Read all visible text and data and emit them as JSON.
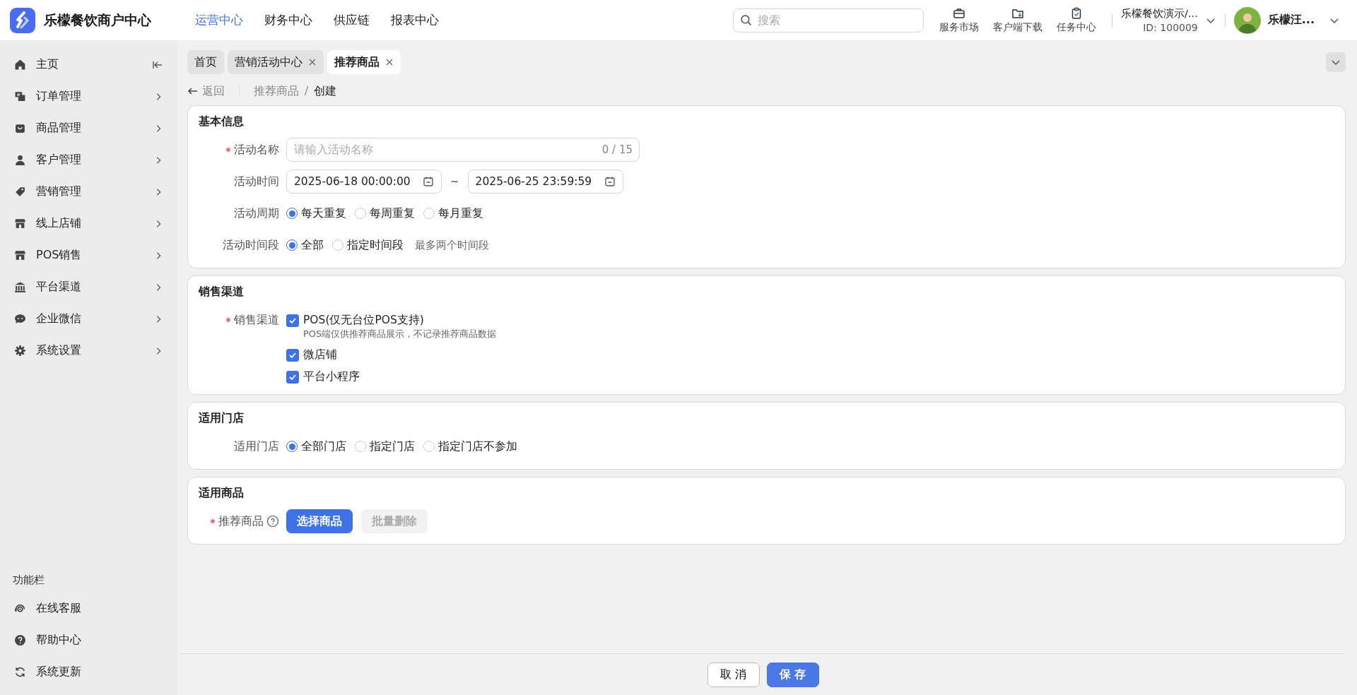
{
  "logo": {
    "title": "乐檬餐饮商户中心"
  },
  "top_nav": [
    {
      "label": "运营中心",
      "selected": true
    },
    {
      "label": "财务中心",
      "selected": false
    },
    {
      "label": "供应链",
      "selected": false
    },
    {
      "label": "报表中心",
      "selected": false
    }
  ],
  "search": {
    "placeholder": "搜索"
  },
  "tools": [
    {
      "label": "服务市场"
    },
    {
      "label": "客户端下载"
    },
    {
      "label": "任务中心"
    }
  ],
  "account": {
    "name": "乐檬餐饮演示/...",
    "id": "ID: 100009"
  },
  "user": {
    "name": "乐檬汪..."
  },
  "sidebar": {
    "items": [
      {
        "label": "主页",
        "kind": "link"
      },
      {
        "label": "订单管理",
        "kind": "menu"
      },
      {
        "label": "商品管理",
        "kind": "menu"
      },
      {
        "label": "客户管理",
        "kind": "menu"
      },
      {
        "label": "营销管理",
        "kind": "menu"
      },
      {
        "label": "线上店铺",
        "kind": "menu"
      },
      {
        "label": "POS销售",
        "kind": "menu"
      },
      {
        "label": "平台渠道",
        "kind": "menu"
      },
      {
        "label": "企业微信",
        "kind": "menu"
      },
      {
        "label": "系统设置",
        "kind": "menu"
      }
    ],
    "section_title": "功能栏",
    "tools": [
      {
        "label": "在线客服"
      },
      {
        "label": "帮助中心"
      },
      {
        "label": "系统更新"
      }
    ]
  },
  "tabs": [
    {
      "label": "首页",
      "closable": false,
      "selected": false
    },
    {
      "label": "营销活动中心",
      "closable": true,
      "selected": false
    },
    {
      "label": "推荐商品",
      "closable": true,
      "selected": true
    }
  ],
  "breadcrumb": {
    "back": "返回",
    "separator": "/",
    "items": [
      "推荐商品",
      "创建"
    ]
  },
  "sections": [
    {
      "title": "基本信息",
      "rows": [
        {
          "kind": "text",
          "label": "活动名称",
          "required": true,
          "placeholder": "请输入活动名称",
          "counter": "0 / 15"
        },
        {
          "kind": "daterange",
          "label": "活动时间",
          "required": false,
          "start": "2025-06-18 00:00:00",
          "separator": "~",
          "end": "2025-06-25 23:59:59"
        },
        {
          "kind": "radio",
          "label": "活动周期",
          "required": false,
          "options": [
            {
              "label": "每天重复",
              "selected": true
            },
            {
              "label": "每周重复",
              "selected": false
            },
            {
              "label": "每月重复",
              "selected": false
            }
          ]
        },
        {
          "kind": "radio",
          "label": "活动时间段",
          "required": false,
          "options": [
            {
              "label": "全部",
              "selected": true
            },
            {
              "label": "指定时间段",
              "selected": false
            }
          ],
          "hint": "最多两个时间段"
        }
      ]
    },
    {
      "title": "销售渠道",
      "rows": [
        {
          "kind": "checkbox",
          "label": "销售渠道",
          "required": true,
          "options": [
            {
              "label": "POS(仅无台位POS支持)",
              "checked": true,
              "note": "POS端仅供推荐商品展示，不记录推荐商品数据"
            },
            {
              "label": "微店铺",
              "checked": true
            },
            {
              "label": "平台小程序",
              "checked": true
            }
          ]
        }
      ]
    },
    {
      "title": "适用门店",
      "rows": [
        {
          "kind": "radio",
          "label": "适用门店",
          "required": false,
          "options": [
            {
              "label": "全部门店",
              "selected": true
            },
            {
              "label": "指定门店",
              "selected": false
            },
            {
              "label": "指定门店不参加",
              "selected": false
            }
          ]
        }
      ]
    },
    {
      "title": "适用商品",
      "rows": [
        {
          "kind": "buttons",
          "label": "推荐商品",
          "required": true,
          "help": true,
          "buttons": [
            {
              "label": "选择商品",
              "kind": "primary",
              "disabled": false
            },
            {
              "label": "批量删除",
              "kind": "default",
              "disabled": true
            }
          ]
        }
      ]
    }
  ],
  "footer": {
    "buttons": [
      {
        "label": "取消",
        "kind": "default"
      },
      {
        "label": "保存",
        "kind": "primary"
      }
    ]
  }
}
